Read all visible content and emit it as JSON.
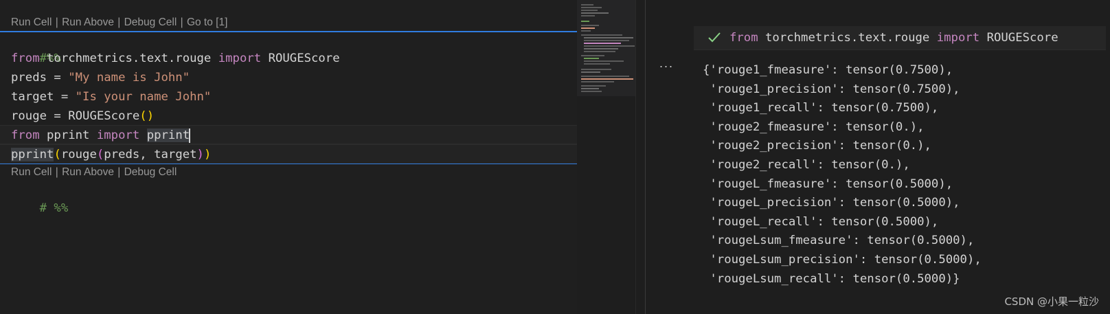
{
  "editor": {
    "codelens_top": {
      "run_cell": "Run Cell",
      "run_above": "Run Above",
      "debug_cell": "Debug Cell",
      "goto": "Go to [1]",
      "separator": "|"
    },
    "codelens_bottom": {
      "run_cell": "Run Cell",
      "run_above": "Run Above",
      "debug_cell": "Debug Cell",
      "separator": "|"
    },
    "lines": {
      "l1": {
        "comment": "#%%"
      },
      "l2": {
        "kw1": "from",
        "mid": " torchmetrics.text.rouge ",
        "kw2": "import",
        "tail": " ROUGEScore"
      },
      "l3": {
        "head": "preds = ",
        "str": "\"My name is John\""
      },
      "l4": {
        "head": "target = ",
        "str": "\"Is your name John\""
      },
      "l5": {
        "head": "rouge = ROUGEScore",
        "open": "(",
        "close": ")"
      },
      "l6": {
        "kw1": "from",
        "mid": " pprint ",
        "kw2": "import",
        "space": " ",
        "sel": "pprint"
      },
      "l7": {
        "sel": "pprint",
        "open": "(",
        "mid": "rouge",
        "open2": "(",
        "args": "preds, target",
        "close2": ")",
        "close": ")"
      },
      "l8": {
        "comment": "# %%"
      }
    }
  },
  "output": {
    "header_kw1": "from",
    "header_mid": " torchmetrics.text.rouge ",
    "header_kw2": "import",
    "header_tail": " ROUGEScore",
    "header_more": "…",
    "ellipsis": "···",
    "lines": [
      "{'rouge1_fmeasure': tensor(0.7500),",
      " 'rouge1_precision': tensor(0.7500),",
      " 'rouge1_recall': tensor(0.7500),",
      " 'rouge2_fmeasure': tensor(0.),",
      " 'rouge2_precision': tensor(0.),",
      " 'rouge2_recall': tensor(0.),",
      " 'rougeL_fmeasure': tensor(0.5000),",
      " 'rougeL_precision': tensor(0.5000),",
      " 'rougeL_recall': tensor(0.5000),",
      " 'rougeLsum_fmeasure': tensor(0.5000),",
      " 'rougeLsum_precision': tensor(0.5000),",
      " 'rougeLsum_recall': tensor(0.5000)}"
    ]
  },
  "watermark": "CSDN @小果一粒沙",
  "colors": {
    "keyword": "#c586c0",
    "string": "#ce9178",
    "comment": "#6a9955",
    "cell_border": "#2f7ce0",
    "success_check": "#89d185"
  }
}
